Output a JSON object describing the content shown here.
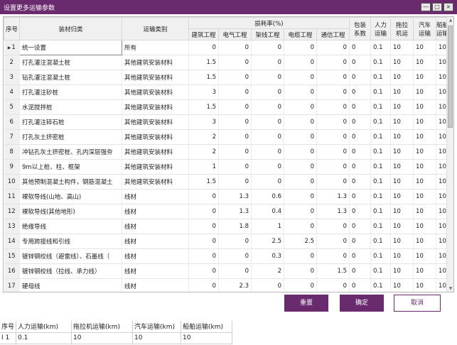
{
  "window": {
    "title": "设置更多运输参数",
    "min": "—",
    "max": "□",
    "close": "×"
  },
  "grid": {
    "headers": {
      "no": "序号",
      "name": "装材归类",
      "type": "运输类别",
      "loss": "损耗率(%)",
      "loss_cols": [
        "建筑工程",
        "电气工程",
        "架线工程",
        "电缆工程",
        "通信工程"
      ],
      "pack": [
        "包装",
        "系数"
      ],
      "labor": [
        "人力",
        "运输"
      ],
      "tractor": [
        "拖拉",
        "机运"
      ],
      "truck": [
        "汽车",
        "运输"
      ],
      "ship": [
        "船舶",
        "运输"
      ]
    },
    "rows": [
      {
        "no": "1",
        "name": "统一设置",
        "type": "所有",
        "loss": [
          "0",
          "0",
          "0",
          "0",
          "0"
        ],
        "pack": "0",
        "labor": "0.1",
        "tractor": "10",
        "truck": "10",
        "ship": "10"
      },
      {
        "no": "2",
        "name": "打孔灌注混凝土桩",
        "type": "其他建筑安装材料",
        "loss": [
          "1.5",
          "0",
          "0",
          "0",
          "0"
        ],
        "pack": "0",
        "labor": "0.1",
        "tractor": "10",
        "truck": "10",
        "ship": "10"
      },
      {
        "no": "3",
        "name": "钻孔灌注混凝土桩",
        "type": "其他建筑安装材料",
        "loss": [
          "1.5",
          "0",
          "0",
          "0",
          "0"
        ],
        "pack": "0",
        "labor": "0.1",
        "tractor": "10",
        "truck": "10",
        "ship": "10"
      },
      {
        "no": "4",
        "name": "打孔灌注砂桩",
        "type": "其他建筑安装材料",
        "loss": [
          "3",
          "0",
          "0",
          "0",
          "0"
        ],
        "pack": "0",
        "labor": "0.1",
        "tractor": "10",
        "truck": "10",
        "ship": "10"
      },
      {
        "no": "5",
        "name": "水泥搅拌桩",
        "type": "其他建筑安装材料",
        "loss": [
          "1.5",
          "0",
          "0",
          "0",
          "0"
        ],
        "pack": "0",
        "labor": "0.1",
        "tractor": "10",
        "truck": "10",
        "ship": "10"
      },
      {
        "no": "6",
        "name": "打孔灌注碎石桩",
        "type": "其他建筑安装材料",
        "loss": [
          "3",
          "0",
          "0",
          "0",
          "0"
        ],
        "pack": "0",
        "labor": "0.1",
        "tractor": "10",
        "truck": "10",
        "ship": "10"
      },
      {
        "no": "7",
        "name": "打孔灰土挤密桩",
        "type": "其他建筑安装材料",
        "loss": [
          "2",
          "0",
          "0",
          "0",
          "0"
        ],
        "pack": "0",
        "labor": "0.1",
        "tractor": "10",
        "truck": "10",
        "ship": "10"
      },
      {
        "no": "8",
        "name": "冲钻孔灰土挤密桩、孔内深层强夯",
        "type": "其他建筑安装材料",
        "loss": [
          "2",
          "0",
          "0",
          "0",
          "0"
        ],
        "pack": "0",
        "labor": "0.1",
        "tractor": "10",
        "truck": "10",
        "ship": "10"
      },
      {
        "no": "9",
        "name": "9m以上桩、柱、框架",
        "type": "其他建筑安装材料",
        "loss": [
          "1",
          "0",
          "0",
          "0",
          "0"
        ],
        "pack": "0",
        "labor": "0.1",
        "tractor": "10",
        "truck": "10",
        "ship": "10"
      },
      {
        "no": "10",
        "name": "其他预制混凝土构件，钢筋混凝土",
        "type": "其他建筑安装材料",
        "loss": [
          "1.5",
          "0",
          "0",
          "0",
          "0"
        ],
        "pack": "0",
        "labor": "0.1",
        "tractor": "10",
        "truck": "10",
        "ship": "10"
      },
      {
        "no": "11",
        "name": "裸软导线(山地、高山)",
        "type": "线材",
        "loss": [
          "0",
          "1.3",
          "0.6",
          "0",
          "1.3"
        ],
        "pack": "0",
        "labor": "0.1",
        "tractor": "10",
        "truck": "10",
        "ship": "10"
      },
      {
        "no": "12",
        "name": "裸软导线(其他地形)",
        "type": "线材",
        "loss": [
          "0",
          "1.3",
          "0.4",
          "0",
          "1.3"
        ],
        "pack": "0",
        "labor": "0.1",
        "tractor": "10",
        "truck": "10",
        "ship": "10"
      },
      {
        "no": "13",
        "name": "绝缘导线",
        "type": "线材",
        "loss": [
          "0",
          "1.8",
          "1",
          "0",
          "0"
        ],
        "pack": "0",
        "labor": "0.1",
        "tractor": "10",
        "truck": "10",
        "ship": "10"
      },
      {
        "no": "14",
        "name": "专用跨接线和引线",
        "type": "线材",
        "loss": [
          "0",
          "0",
          "2.5",
          "2.5",
          "0"
        ],
        "pack": "0",
        "labor": "0.1",
        "tractor": "10",
        "truck": "10",
        "ship": "10"
      },
      {
        "no": "15",
        "name": "镀锌钢绞线（避雷线）、石墨线（",
        "type": "线材",
        "loss": [
          "0",
          "0",
          "0.3",
          "0",
          "0"
        ],
        "pack": "0",
        "labor": "0.1",
        "tractor": "10",
        "truck": "10",
        "ship": "10"
      },
      {
        "no": "16",
        "name": "镀锌钢绞线（拉线、承力线）",
        "type": "线材",
        "loss": [
          "0",
          "0",
          "2",
          "0",
          "1.5"
        ],
        "pack": "0",
        "labor": "0.1",
        "tractor": "10",
        "truck": "10",
        "ship": "10"
      },
      {
        "no": "17",
        "name": "硬母线",
        "type": "线材",
        "loss": [
          "0",
          "2.3",
          "0",
          "0",
          "0"
        ],
        "pack": "0",
        "labor": "0.1",
        "tractor": "10",
        "truck": "10",
        "ship": "10"
      },
      {
        "no": "18",
        "name": "绝缘子",
        "type": "金具、绝缘子、零星钢",
        "loss": [
          "0",
          "2",
          "2",
          "0",
          "0"
        ],
        "pack": "0",
        "labor": "0.1",
        "tractor": "10",
        "truck": "10",
        "ship": "10"
      }
    ]
  },
  "buttons": {
    "reset": "重置",
    "ok": "确定",
    "cancel": "取消"
  },
  "bottom": {
    "headers": [
      "序号",
      "人力运输(km)",
      "拖拉机运输(km)",
      "汽车运输(km)",
      "船舶运输(km)"
    ],
    "row": [
      "1",
      "0.1",
      "10",
      "10",
      "10"
    ]
  },
  "colors": {
    "accent": "#6a2a6e"
  }
}
